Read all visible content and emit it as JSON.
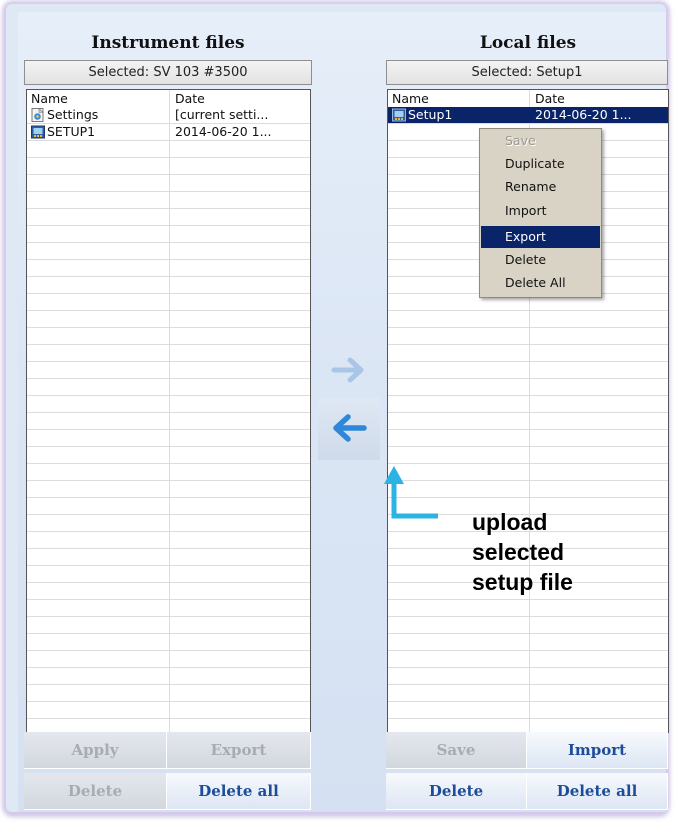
{
  "instrument": {
    "title": "Instrument files",
    "selected": "Selected: SV 103 #3500",
    "columns": [
      "Name",
      "Date"
    ],
    "files": [
      {
        "name": "Settings",
        "date": "[current setti...",
        "icon": "settings-file-icon"
      },
      {
        "name": "SETUP1",
        "date": "2014-06-20 1...",
        "icon": "setup-file-icon"
      }
    ],
    "buttons": {
      "apply": "Apply",
      "export": "Export",
      "delete": "Delete",
      "delete_all": "Delete all"
    }
  },
  "local": {
    "title": "Local files",
    "selected": "Selected: Setup1",
    "columns": [
      "Name",
      "Date"
    ],
    "files": [
      {
        "name": "Setup1",
        "date": "2014-06-20 1...",
        "icon": "setup-file-icon",
        "selected": true
      }
    ],
    "buttons": {
      "save": "Save",
      "import": "Import",
      "delete": "Delete",
      "delete_all": "Delete all"
    }
  },
  "transfer": {
    "download_icon": "arrow-right-icon",
    "upload_icon": "arrow-left-icon"
  },
  "context_menu": {
    "items": [
      {
        "label": "Save",
        "state": "disabled"
      },
      {
        "label": "Duplicate",
        "state": "normal"
      },
      {
        "label": "Rename",
        "state": "normal"
      },
      {
        "label": "Import",
        "state": "normal"
      },
      {
        "label": "Export",
        "state": "highlighted"
      },
      {
        "label": "Delete",
        "state": "normal"
      },
      {
        "label": "Delete All",
        "state": "normal"
      }
    ]
  },
  "annotation": {
    "line1": "upload",
    "line2": "selected",
    "line3": "setup file",
    "color": "#2bb3e3"
  },
  "colors": {
    "selection": "#0a246a",
    "button_text": "#1d4d9a",
    "disabled_text": "#a7acb3"
  }
}
